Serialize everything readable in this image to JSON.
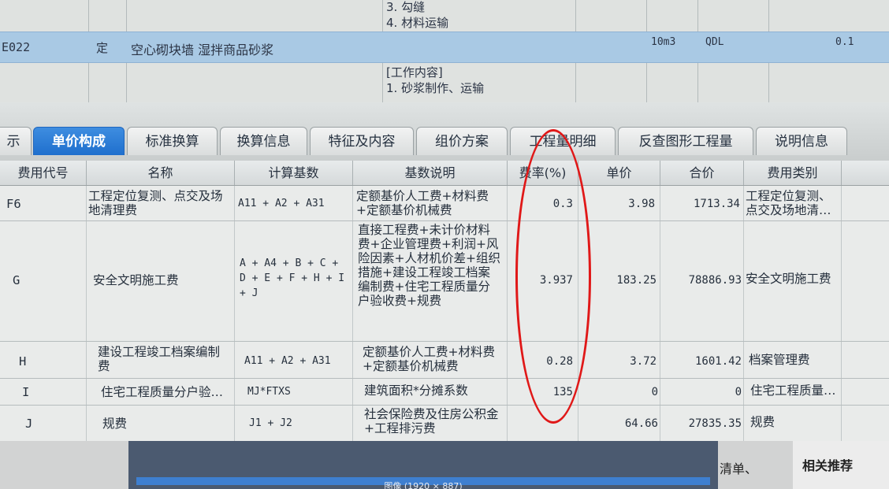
{
  "top_rows": {
    "row1": {
      "content_lines": [
        "3. 勾缝",
        "4. 材料运输"
      ]
    },
    "row2": {
      "code": "E022",
      "type": "定",
      "name": "空心砌块墙 湿拌商品砂浆",
      "unit": "10m3",
      "qty_expr": "QDL",
      "qty": "0.1"
    },
    "row3": {
      "content_lines": [
        "[工作内容]",
        "1. 砂浆制作、运输"
      ]
    }
  },
  "tabs": [
    {
      "label": "示"
    },
    {
      "label": "单价构成",
      "active": true
    },
    {
      "label": "标准换算"
    },
    {
      "label": "换算信息"
    },
    {
      "label": "特征及内容"
    },
    {
      "label": "组价方案"
    },
    {
      "label": "工程量明细"
    },
    {
      "label": "反查图形工程量"
    },
    {
      "label": "说明信息"
    }
  ],
  "columns": [
    "费用代号",
    "名称",
    "计算基数",
    "基数说明",
    "费率(%)",
    "单价",
    "合价",
    "费用类别"
  ],
  "rows": [
    {
      "code": "F6",
      "name": "工程定位复测、点交及场地清理费",
      "base": "A11 + A2 + A31",
      "base_desc": "定额基价人工费+材料费+定额基价机械费",
      "rate": "0.3",
      "price": "3.98",
      "total": "1713.34",
      "category": "工程定位复测、点交及场地清…"
    },
    {
      "code": "G",
      "name": "安全文明施工费",
      "base": "A + A4 + B + C + D + E + F + H + I + J",
      "base_desc": "直接工程费+未计价材料费+企业管理费+利润+风险因素+人材机价差+组织措施+建设工程竣工档案编制费+住宅工程质量分户验收费+规费",
      "rate": "3.937",
      "price": "183.25",
      "total": "78886.93",
      "category": "安全文明施工费"
    },
    {
      "code": "H",
      "name": "建设工程竣工档案编制费",
      "base": "A11 + A2 + A31",
      "base_desc": "定额基价人工费+材料费+定额基价机械费",
      "rate": "0.28",
      "price": "3.72",
      "total": "1601.42",
      "category": "档案管理费"
    },
    {
      "code": "I",
      "name": "住宅工程质量分户验…",
      "base": "MJ*FTXS",
      "base_desc": "建筑面积*分摊系数",
      "rate": "135",
      "price": "0",
      "total": "0",
      "category": "住宅工程质量…"
    },
    {
      "code": "J",
      "name": "规费",
      "base": "J1 + J2",
      "base_desc": "社会保险费及住房公积金+工程排污费",
      "rate": "",
      "price": "64.66",
      "total": "27835.35",
      "category": "规费"
    }
  ],
  "bottom": {
    "image_caption": "图像 (1920 × 887)",
    "right_link": "清单、",
    "related": "相关推荐"
  },
  "colors": {
    "active_tab": "#1f6fcd",
    "highlight_row": "#a9c9e4",
    "annotation": "#e01818"
  }
}
